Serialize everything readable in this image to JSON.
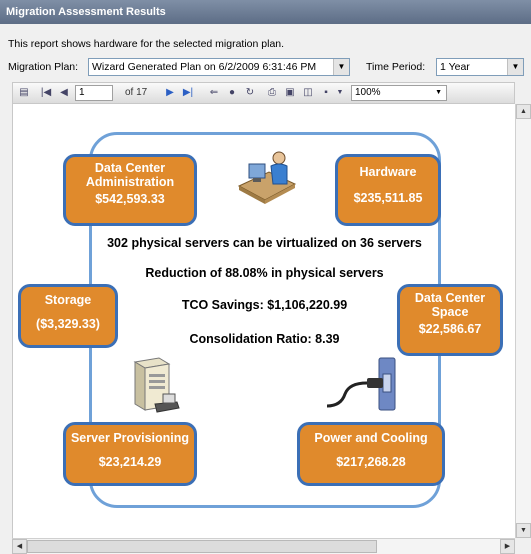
{
  "window": {
    "title": "Migration Assessment Results"
  },
  "description": "This report shows hardware for the selected migration plan.",
  "filters": {
    "plan_label": "Migration Plan:",
    "plan_value": "Wizard Generated Plan on 6/2/2009 6:31:46 PM",
    "period_label": "Time Period:",
    "period_value": "1 Year"
  },
  "toolbar": {
    "page_current": "1",
    "page_of": "of 17",
    "zoom": "100%"
  },
  "report": {
    "boxes": {
      "dc_admin": {
        "title_line1": "Data Center",
        "title_line2": "Administration",
        "value": "$542,593.33"
      },
      "hardware": {
        "title": "Hardware",
        "value": "$235,511.85"
      },
      "storage": {
        "title": "Storage",
        "value": "($3,329.33)"
      },
      "dc_space": {
        "title_line1": "Data Center",
        "title_line2": "Space",
        "value": "$22,586.67"
      },
      "server_prov": {
        "title": "Server Provisioning",
        "value": "$23,214.29"
      },
      "power": {
        "title": "Power and Cooling",
        "value": "$217,268.28"
      }
    },
    "lines": {
      "virtualized": "302 physical servers can be virtualized on 36 servers",
      "reduction": "Reduction of 88.08% in physical servers",
      "tco": "TCO Savings: $1,106,220.99",
      "ratio": "Consolidation Ratio:  8.39"
    }
  },
  "icons": {
    "person": "person-at-computer-icon",
    "server": "server-tower-icon",
    "power": "power-plug-icon"
  }
}
